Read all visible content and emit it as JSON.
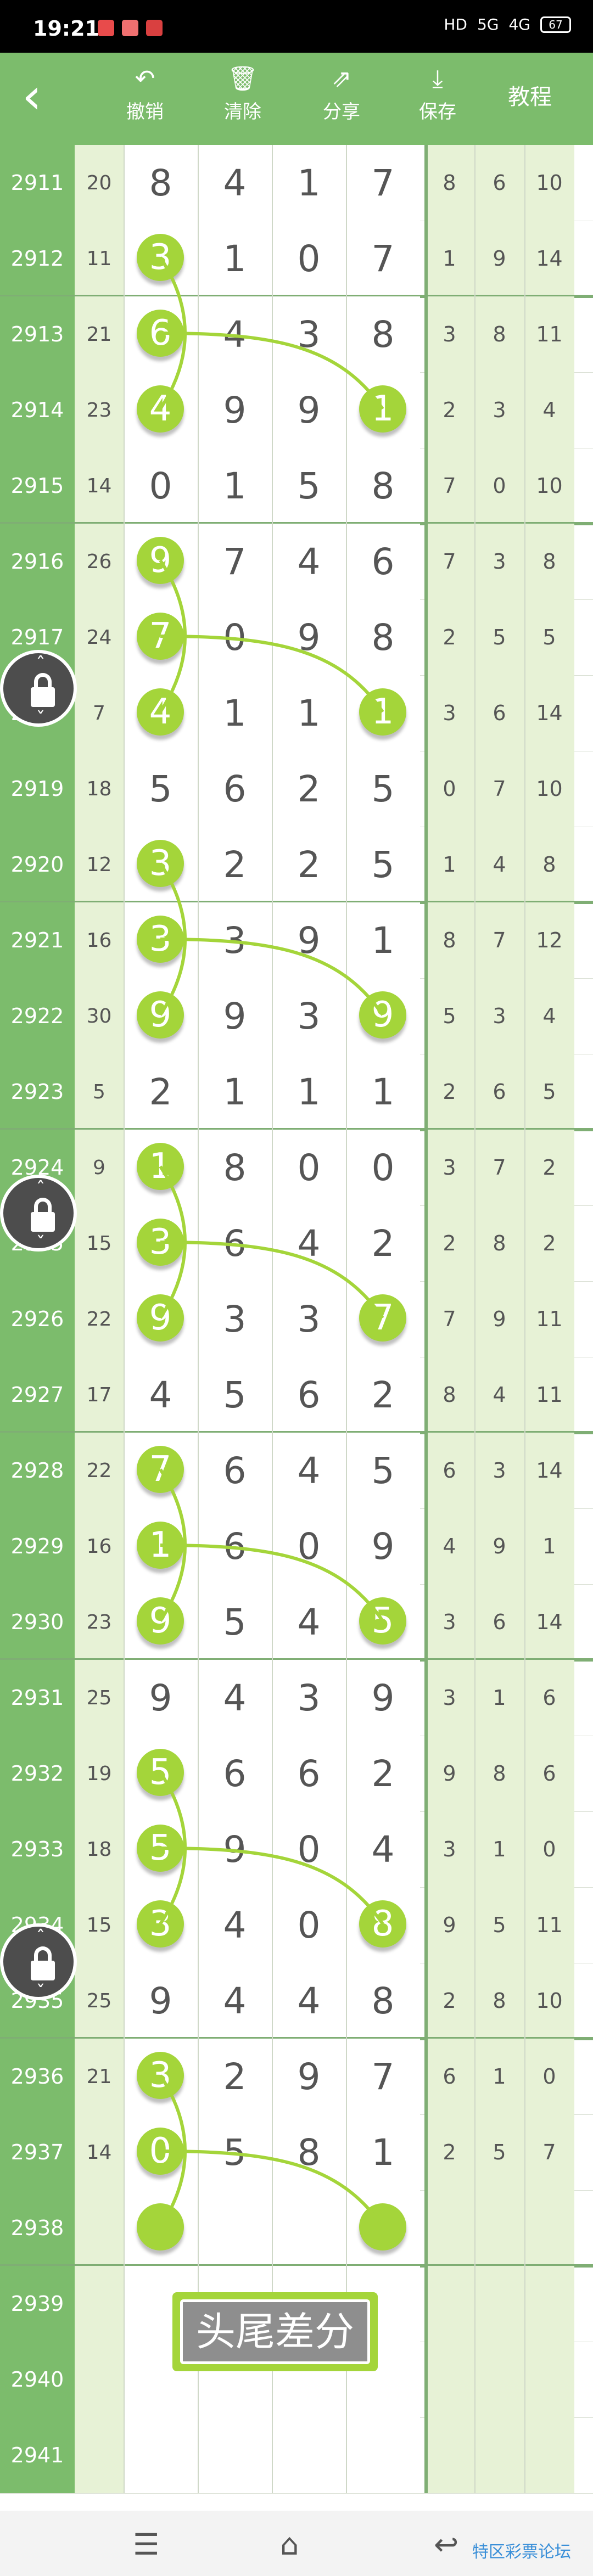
{
  "status_bar": {
    "time": "19:21",
    "network": "5G",
    "signal": "4G",
    "battery": "67"
  },
  "toolbar": {
    "undo_label": "撤销",
    "undo_icon": "undo-arrow",
    "clear_label": "清除",
    "clear_icon": "trash",
    "share_label": "分享",
    "share_icon": "share",
    "save_label": "保存",
    "save_icon": "download",
    "tutorial_label": "教程"
  },
  "rows": [
    {
      "issue": "2911",
      "sum": "20",
      "digits": [
        "8",
        "4",
        "1",
        "7"
      ],
      "right": [
        "8",
        "6",
        "10"
      ]
    },
    {
      "issue": "2912",
      "sum": "11",
      "digits": [
        "3",
        "1",
        "0",
        "7"
      ],
      "right": [
        "1",
        "9",
        "14"
      ],
      "hl": [
        0
      ]
    },
    {
      "issue": "2913",
      "sum": "21",
      "digits": [
        "6",
        "4",
        "3",
        "8"
      ],
      "right": [
        "3",
        "8",
        "11"
      ],
      "hl": [
        0
      ]
    },
    {
      "issue": "2914",
      "sum": "23",
      "digits": [
        "4",
        "9",
        "9",
        "1"
      ],
      "right": [
        "2",
        "3",
        "4"
      ],
      "hl": [
        0,
        3
      ]
    },
    {
      "issue": "2915",
      "sum": "14",
      "digits": [
        "0",
        "1",
        "5",
        "8"
      ],
      "right": [
        "7",
        "0",
        "10"
      ]
    },
    {
      "issue": "2916",
      "sum": "26",
      "digits": [
        "9",
        "7",
        "4",
        "6"
      ],
      "right": [
        "7",
        "3",
        "8"
      ],
      "hl": [
        0
      ]
    },
    {
      "issue": "2917",
      "sum": "24",
      "digits": [
        "7",
        "0",
        "9",
        "8"
      ],
      "right": [
        "2",
        "5",
        "5"
      ],
      "hl": [
        0
      ]
    },
    {
      "issue": "2918",
      "sum": "7",
      "digits": [
        "4",
        "1",
        "1",
        "1"
      ],
      "right": [
        "3",
        "6",
        "14"
      ],
      "hl": [
        0,
        3
      ]
    },
    {
      "issue": "2919",
      "sum": "18",
      "digits": [
        "5",
        "6",
        "2",
        "5"
      ],
      "right": [
        "0",
        "7",
        "10"
      ]
    },
    {
      "issue": "2920",
      "sum": "12",
      "digits": [
        "3",
        "2",
        "2",
        "5"
      ],
      "right": [
        "1",
        "4",
        "8"
      ],
      "hl": [
        0
      ]
    },
    {
      "issue": "2921",
      "sum": "16",
      "digits": [
        "3",
        "3",
        "9",
        "1"
      ],
      "right": [
        "8",
        "7",
        "12"
      ],
      "hl": [
        0
      ]
    },
    {
      "issue": "2922",
      "sum": "30",
      "digits": [
        "9",
        "9",
        "3",
        "9"
      ],
      "right": [
        "5",
        "3",
        "4"
      ],
      "hl": [
        0,
        3
      ]
    },
    {
      "issue": "2923",
      "sum": "5",
      "digits": [
        "2",
        "1",
        "1",
        "1"
      ],
      "right": [
        "2",
        "6",
        "5"
      ]
    },
    {
      "issue": "2924",
      "sum": "9",
      "digits": [
        "1",
        "8",
        "0",
        "0"
      ],
      "right": [
        "3",
        "7",
        "2"
      ],
      "hl": [
        0
      ]
    },
    {
      "issue": "2925",
      "sum": "15",
      "digits": [
        "3",
        "6",
        "4",
        "2"
      ],
      "right": [
        "2",
        "8",
        "2"
      ],
      "hl": [
        0
      ]
    },
    {
      "issue": "2926",
      "sum": "22",
      "digits": [
        "9",
        "3",
        "3",
        "7"
      ],
      "right": [
        "7",
        "9",
        "11"
      ],
      "hl": [
        0,
        3
      ]
    },
    {
      "issue": "2927",
      "sum": "17",
      "digits": [
        "4",
        "5",
        "6",
        "2"
      ],
      "right": [
        "8",
        "4",
        "11"
      ]
    },
    {
      "issue": "2928",
      "sum": "22",
      "digits": [
        "7",
        "6",
        "4",
        "5"
      ],
      "right": [
        "6",
        "3",
        "14"
      ],
      "hl": [
        0
      ]
    },
    {
      "issue": "2929",
      "sum": "16",
      "digits": [
        "1",
        "6",
        "0",
        "9"
      ],
      "right": [
        "4",
        "9",
        "1"
      ],
      "hl": [
        0
      ]
    },
    {
      "issue": "2930",
      "sum": "23",
      "digits": [
        "9",
        "5",
        "4",
        "5"
      ],
      "right": [
        "3",
        "6",
        "14"
      ],
      "hl": [
        0,
        3
      ]
    },
    {
      "issue": "2931",
      "sum": "25",
      "digits": [
        "9",
        "4",
        "3",
        "9"
      ],
      "right": [
        "3",
        "1",
        "6"
      ]
    },
    {
      "issue": "2932",
      "sum": "19",
      "digits": [
        "5",
        "6",
        "6",
        "2"
      ],
      "right": [
        "9",
        "8",
        "6"
      ],
      "hl": [
        0
      ]
    },
    {
      "issue": "2933",
      "sum": "18",
      "digits": [
        "5",
        "9",
        "0",
        "4"
      ],
      "right": [
        "3",
        "1",
        "0"
      ],
      "hl": [
        0
      ]
    },
    {
      "issue": "2934",
      "sum": "15",
      "digits": [
        "3",
        "4",
        "0",
        "8"
      ],
      "right": [
        "9",
        "5",
        "11"
      ],
      "hl": [
        0,
        3
      ]
    },
    {
      "issue": "2935",
      "sum": "25",
      "digits": [
        "9",
        "4",
        "4",
        "8"
      ],
      "right": [
        "2",
        "8",
        "10"
      ]
    },
    {
      "issue": "2936",
      "sum": "21",
      "digits": [
        "3",
        "2",
        "9",
        "7"
      ],
      "right": [
        "6",
        "1",
        "0"
      ],
      "hl": [
        0
      ]
    },
    {
      "issue": "2937",
      "sum": "14",
      "digits": [
        "0",
        "5",
        "8",
        "1"
      ],
      "right": [
        "2",
        "5",
        "7"
      ],
      "hl": [
        0
      ]
    },
    {
      "issue": "2938",
      "sum": "",
      "digits": [
        "",
        "",
        "",
        ""
      ],
      "right": [
        "",
        "",
        ""
      ],
      "hl": [
        0,
        3
      ]
    },
    {
      "issue": "2939",
      "sum": "",
      "digits": [
        "",
        "",
        "",
        ""
      ],
      "right": [
        "",
        "",
        ""
      ]
    },
    {
      "issue": "2940",
      "sum": "",
      "digits": [
        "",
        "",
        "",
        ""
      ],
      "right": [
        "",
        "",
        ""
      ]
    },
    {
      "issue": "2941",
      "sum": "",
      "digits": [
        "",
        "",
        "",
        ""
      ],
      "right": [
        "",
        "",
        ""
      ]
    }
  ],
  "overlay_label": "头尾差分",
  "nav": {
    "menu_icon": "menu-lines",
    "home_icon": "home",
    "back_icon": "back-arrow"
  },
  "watermark": "特区彩票论坛",
  "colors": {
    "accent": "#7cbc6c",
    "highlight": "#a4d53a",
    "panel": "#e7f2d6"
  }
}
